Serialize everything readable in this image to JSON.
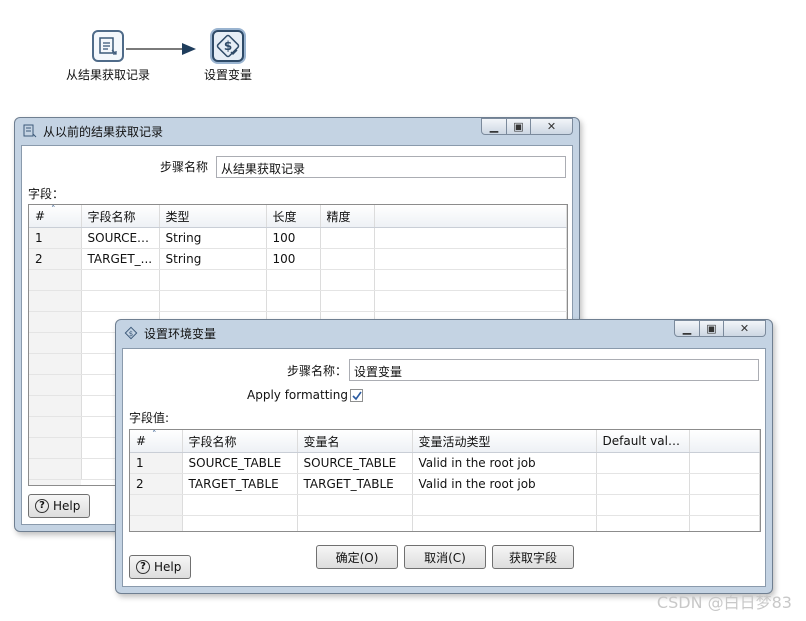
{
  "canvas": {
    "step1_label": "从结果获取记录",
    "step2_label": "设置变量"
  },
  "dialog_back": {
    "title": "从以前的结果获取记录",
    "step_name_label": "步骤名称",
    "step_name_value": "从结果获取记录",
    "fields_label": "字段：",
    "columns": [
      "#",
      "字段名称",
      "类型",
      "长度",
      "精度"
    ],
    "rows": [
      [
        "1",
        "SOURCE_...",
        "String",
        "100",
        ""
      ],
      [
        "2",
        "TARGET_...",
        "String",
        "100",
        ""
      ]
    ],
    "help_label": "Help"
  },
  "dialog_front": {
    "title": "设置环境变量",
    "step_name_label": "步骤名称：",
    "step_name_value": "设置变量",
    "apply_formatting_label": "Apply formatting",
    "apply_formatting_checked": true,
    "field_values_label": "字段值:",
    "columns": [
      "#",
      "字段名称",
      "变量名",
      "变量活动类型",
      "Default value"
    ],
    "rows": [
      [
        "1",
        "SOURCE_TABLE",
        "SOURCE_TABLE",
        "Valid in the root job",
        ""
      ],
      [
        "2",
        "TARGET_TABLE",
        "TARGET_TABLE",
        "Valid in the root job",
        ""
      ]
    ],
    "ok_label": "确定(O)",
    "cancel_label": "取消(C)",
    "get_fields_label": "获取字段",
    "help_label": "Help"
  },
  "watermark": "CSDN @白日梦83"
}
